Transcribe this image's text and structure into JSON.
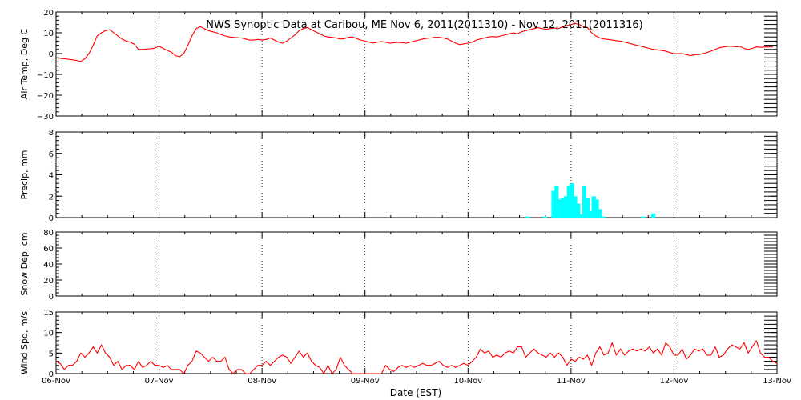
{
  "chart_data": {
    "type": "line",
    "title": "NWS Synoptic Data at Caribou, ME   Nov  6, 2011(2011310) - Nov 12, 2011(2011316)",
    "xlabel": "Date (EST)",
    "x_tick_labels": [
      "06-Nov",
      "07-Nov",
      "08-Nov",
      "09-Nov",
      "10-Nov",
      "11-Nov",
      "12-Nov",
      "13-Nov"
    ],
    "xlim_days": [
      0,
      7
    ],
    "grid": "dotted vertical lines at each day boundary",
    "panels": [
      {
        "name": "air-temp",
        "type": "line",
        "ylabel": "Air Temp, Deg C",
        "ylim": [
          -30,
          20
        ],
        "ytick_labels": [
          "−30",
          "−20",
          "−10",
          "0",
          "10",
          "20"
        ],
        "ytick_values": [
          -30,
          -20,
          -10,
          0,
          10,
          20
        ],
        "color": "#ff0000",
        "x": [
          0,
          0.04,
          0.08,
          0.12,
          0.16,
          0.2,
          0.24,
          0.28,
          0.32,
          0.36,
          0.4,
          0.44,
          0.48,
          0.52,
          0.56,
          0.6,
          0.64,
          0.68,
          0.72,
          0.76,
          0.8,
          0.84,
          0.88,
          0.92,
          0.96,
          1.0,
          1.04,
          1.08,
          1.12,
          1.16,
          1.2,
          1.24,
          1.28,
          1.32,
          1.36,
          1.4,
          1.44,
          1.48,
          1.52,
          1.56,
          1.6,
          1.64,
          1.68,
          1.72,
          1.76,
          1.8,
          1.84,
          1.88,
          1.92,
          1.96,
          2.0,
          2.04,
          2.08,
          2.12,
          2.16,
          2.2,
          2.24,
          2.28,
          2.32,
          2.36,
          2.4,
          2.44,
          2.48,
          2.52,
          2.56,
          2.6,
          2.64,
          2.68,
          2.72,
          2.76,
          2.8,
          2.84,
          2.88,
          2.92,
          2.96,
          3.0,
          3.04,
          3.08,
          3.12,
          3.16,
          3.2,
          3.24,
          3.28,
          3.32,
          3.36,
          3.4,
          3.44,
          3.48,
          3.52,
          3.56,
          3.6,
          3.64,
          3.68,
          3.72,
          3.76,
          3.8,
          3.84,
          3.88,
          3.92,
          3.96,
          4.0,
          4.04,
          4.08,
          4.12,
          4.16,
          4.2,
          4.24,
          4.28,
          4.32,
          4.36,
          4.4,
          4.44,
          4.48,
          4.52,
          4.56,
          4.6,
          4.64,
          4.68,
          4.72,
          4.76,
          4.8,
          4.84,
          4.88,
          4.92,
          4.96,
          5.0,
          5.04,
          5.08,
          5.12,
          5.16,
          5.2,
          5.24,
          5.28,
          5.32,
          5.36,
          5.4,
          5.44,
          5.48,
          5.52,
          5.56,
          5.6,
          5.64,
          5.68,
          5.72,
          5.76,
          5.8,
          5.84,
          5.88,
          5.92,
          5.96,
          6.0,
          6.04,
          6.08,
          6.12,
          6.16,
          6.2,
          6.24,
          6.28,
          6.32,
          6.36,
          6.4,
          6.44,
          6.48,
          6.52,
          6.56,
          6.6,
          6.64,
          6.68,
          6.72,
          6.76,
          6.8,
          6.84,
          6.88,
          6.92,
          6.96,
          7.0
        ],
        "values": [
          -2,
          -2.3,
          -2.5,
          -2.7,
          -3,
          -3.3,
          -3.8,
          -2.5,
          0,
          4,
          8.5,
          10,
          11,
          11.5,
          10,
          8.5,
          7,
          6,
          5.5,
          4.5,
          2,
          2,
          2.2,
          2.3,
          2.7,
          3.5,
          2.5,
          1.5,
          0.7,
          -1,
          -1.5,
          0,
          4,
          8.5,
          12,
          13,
          12,
          11,
          10.5,
          10,
          9.2,
          8.5,
          8,
          7.8,
          7.7,
          7.5,
          7,
          6.5,
          6.5,
          6.8,
          6.5,
          6.8,
          7.5,
          6.5,
          5.5,
          5,
          6,
          7.5,
          9,
          11,
          12,
          12.5,
          11.5,
          10.5,
          9.5,
          8.5,
          8,
          7.8,
          7.5,
          7,
          7.2,
          7.8,
          8,
          7.2,
          6.5,
          6,
          5.5,
          5,
          5.5,
          5.8,
          5.5,
          5,
          5.2,
          5.4,
          5.2,
          5,
          5.5,
          6,
          6.5,
          7,
          7.3,
          7.5,
          7.8,
          7.8,
          7.5,
          7,
          6,
          5,
          4.3,
          4.7,
          5,
          5.5,
          6.5,
          7,
          7.5,
          8,
          8.2,
          8,
          8.5,
          9,
          9.5,
          10,
          9.5,
          10.5,
          11,
          11.5,
          12,
          12.5,
          12,
          11.7,
          12,
          12.3,
          12,
          13,
          13.5,
          14,
          14.5,
          14,
          13,
          12.5,
          10,
          8.5,
          7.5,
          7,
          6.8,
          6.5,
          6.2,
          6,
          5.5,
          5,
          4.5,
          4,
          3.5,
          3,
          2.5,
          2,
          1.8,
          1.5,
          1.2,
          0.5,
          0,
          0,
          0,
          -0.5,
          -1,
          -0.5,
          -0.5,
          0,
          0.5,
          1.2,
          2,
          2.8,
          3.2,
          3.5,
          3.5,
          3.3,
          3.5,
          2.5,
          2,
          2.5,
          3.2,
          3,
          3.2,
          3.2,
          3.2
        ]
      },
      {
        "name": "precip",
        "type": "bar",
        "ylabel": "Precip, mm",
        "ylim": [
          0,
          8
        ],
        "ytick_labels": [
          "0",
          "2",
          "4",
          "6",
          "8"
        ],
        "ytick_values": [
          0,
          2,
          4,
          6,
          8
        ],
        "color": "#00ffff",
        "bar_width_days": 0.04,
        "x": [
          4.58,
          4.75,
          4.83,
          4.86,
          4.89,
          4.92,
          4.95,
          4.98,
          5.01,
          5.04,
          5.07,
          5.1,
          5.13,
          5.16,
          5.19,
          5.22,
          5.25,
          5.28,
          5.31,
          5.7,
          5.8
        ],
        "values": [
          0.1,
          0.1,
          2.5,
          3.0,
          1.7,
          1.8,
          2.0,
          3.0,
          3.2,
          2.0,
          1.3,
          0.3,
          3.0,
          1.8,
          0.6,
          2.0,
          1.7,
          0.8,
          0.1,
          0.1,
          0.4
        ]
      },
      {
        "name": "snow-depth",
        "type": "line",
        "ylabel": "Snow Dep, cm",
        "ylim": [
          0,
          80
        ],
        "ytick_labels": [
          "0",
          "20",
          "40",
          "60",
          "80"
        ],
        "ytick_values": [
          0,
          20,
          40,
          60,
          80
        ],
        "color": "#ff0000",
        "x": [],
        "values": []
      },
      {
        "name": "wind-speed",
        "type": "line",
        "ylabel": "Wind Spd, m/s",
        "ylim": [
          0,
          15
        ],
        "ytick_labels": [
          "0",
          "5",
          "10",
          "15"
        ],
        "ytick_values": [
          0,
          5,
          10,
          15
        ],
        "color": "#ff0000",
        "x": [
          0,
          0.04,
          0.08,
          0.12,
          0.16,
          0.2,
          0.24,
          0.28,
          0.32,
          0.36,
          0.4,
          0.44,
          0.48,
          0.52,
          0.56,
          0.6,
          0.64,
          0.68,
          0.72,
          0.76,
          0.8,
          0.84,
          0.88,
          0.92,
          0.96,
          1.0,
          1.04,
          1.08,
          1.12,
          1.16,
          1.2,
          1.24,
          1.28,
          1.32,
          1.36,
          1.4,
          1.44,
          1.48,
          1.52,
          1.56,
          1.6,
          1.64,
          1.68,
          1.72,
          1.76,
          1.8,
          1.84,
          1.88,
          1.92,
          1.96,
          2.0,
          2.04,
          2.08,
          2.12,
          2.16,
          2.2,
          2.24,
          2.28,
          2.32,
          2.36,
          2.4,
          2.44,
          2.48,
          2.52,
          2.56,
          2.6,
          2.64,
          2.68,
          2.72,
          2.76,
          2.8,
          2.84,
          2.88,
          2.92,
          2.96,
          3.0,
          3.04,
          3.08,
          3.12,
          3.16,
          3.2,
          3.24,
          3.28,
          3.32,
          3.36,
          3.4,
          3.44,
          3.48,
          3.52,
          3.56,
          3.6,
          3.64,
          3.68,
          3.72,
          3.76,
          3.8,
          3.84,
          3.88,
          3.92,
          3.96,
          4.0,
          4.04,
          4.08,
          4.12,
          4.16,
          4.2,
          4.24,
          4.28,
          4.32,
          4.36,
          4.4,
          4.44,
          4.48,
          4.52,
          4.56,
          4.6,
          4.64,
          4.68,
          4.72,
          4.76,
          4.8,
          4.84,
          4.88,
          4.92,
          4.96,
          5.0,
          5.04,
          5.08,
          5.12,
          5.16,
          5.2,
          5.24,
          5.28,
          5.32,
          5.36,
          5.4,
          5.44,
          5.48,
          5.52,
          5.56,
          5.6,
          5.64,
          5.68,
          5.72,
          5.76,
          5.8,
          5.84,
          5.88,
          5.92,
          5.96,
          6.0,
          6.04,
          6.08,
          6.12,
          6.16,
          6.2,
          6.24,
          6.28,
          6.32,
          6.36,
          6.4,
          6.44,
          6.48,
          6.52,
          6.56,
          6.6,
          6.64,
          6.68,
          6.72,
          6.76,
          6.8,
          6.84,
          6.88,
          6.92,
          6.96,
          7.0
        ],
        "values": [
          3,
          2.5,
          1,
          2,
          2,
          3,
          5,
          4,
          5,
          6.5,
          5,
          7,
          5,
          4,
          2,
          3,
          1,
          2,
          2,
          1,
          3,
          1.5,
          2,
          3,
          2,
          2,
          1.5,
          2,
          1,
          1,
          1,
          0,
          2,
          3,
          5.5,
          5,
          4,
          3,
          4,
          3,
          3,
          4,
          1,
          0,
          1,
          1,
          0,
          0,
          1,
          2,
          2,
          3,
          2,
          3,
          4,
          4.5,
          4,
          2.5,
          4,
          5.5,
          4,
          5,
          3,
          2,
          1.5,
          0,
          2,
          0,
          1,
          4,
          2,
          1,
          0,
          0,
          0,
          0,
          0,
          0,
          0,
          0,
          2,
          1,
          0.5,
          1.5,
          2,
          1.5,
          2,
          1.5,
          2,
          2.5,
          2,
          2,
          2.5,
          3,
          2,
          1.5,
          2,
          1.5,
          2,
          2.5,
          2,
          3,
          4,
          6,
          5,
          5.5,
          4,
          4.5,
          4,
          5,
          5.5,
          5,
          6.5,
          6.5,
          4,
          5,
          6,
          5,
          4.5,
          4,
          5,
          4,
          5,
          4,
          2,
          3.5,
          3,
          4,
          3.5,
          4.5,
          2,
          5,
          6.5,
          4.5,
          5,
          7.5,
          4.5,
          6,
          4.5,
          5.5,
          6,
          5.5,
          6,
          5.5,
          6.5,
          5,
          6,
          4.5,
          7.5,
          6.5,
          4.5,
          4.5,
          6,
          3.5,
          4.5,
          6,
          5.5,
          6,
          4.5,
          4.5,
          6.5,
          4,
          4.5,
          6,
          7,
          6.5,
          6,
          7.5,
          5,
          6.5,
          8,
          5,
          4,
          4,
          3,
          2.5,
          2.5,
          2
        ]
      }
    ]
  }
}
